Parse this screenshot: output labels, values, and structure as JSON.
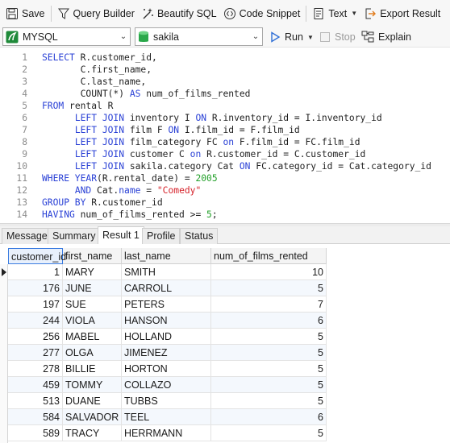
{
  "toolbar": {
    "save_label": "Save",
    "query_builder_label": "Query Builder",
    "beautify_label": "Beautify SQL",
    "code_snippet_label": "Code Snippet",
    "text_label": "Text",
    "export_label": "Export Result"
  },
  "toolbar2": {
    "connection": "MYSQL",
    "database": "sakila",
    "run_label": "Run",
    "stop_label": "Stop",
    "explain_label": "Explain"
  },
  "editor": {
    "line_numbers": [
      "1",
      "2",
      "3",
      "4",
      "5",
      "6",
      "7",
      "8",
      "9",
      "10",
      "11",
      "12",
      "13",
      "14"
    ]
  },
  "tabs": [
    "Message",
    "Summary",
    "Result 1",
    "Profile",
    "Status"
  ],
  "active_tab": "Result 1",
  "result": {
    "columns": [
      "customer_id",
      "first_name",
      "last_name",
      "num_of_films_rented"
    ],
    "rows": [
      [
        "1",
        "MARY",
        "SMITH",
        "10"
      ],
      [
        "176",
        "JUNE",
        "CARROLL",
        "5"
      ],
      [
        "197",
        "SUE",
        "PETERS",
        "7"
      ],
      [
        "244",
        "VIOLA",
        "HANSON",
        "6"
      ],
      [
        "256",
        "MABEL",
        "HOLLAND",
        "5"
      ],
      [
        "277",
        "OLGA",
        "JIMENEZ",
        "5"
      ],
      [
        "278",
        "BILLIE",
        "HORTON",
        "5"
      ],
      [
        "459",
        "TOMMY",
        "COLLAZO",
        "5"
      ],
      [
        "513",
        "DUANE",
        "TUBBS",
        "5"
      ],
      [
        "584",
        "SALVADOR",
        "TEEL",
        "6"
      ],
      [
        "589",
        "TRACY",
        "HERRMANN",
        "5"
      ]
    ]
  },
  "colors": {
    "keyword": "#2a41d6",
    "string": "#d6232b",
    "number": "#23a02a",
    "accent": "#3a7be0"
  }
}
